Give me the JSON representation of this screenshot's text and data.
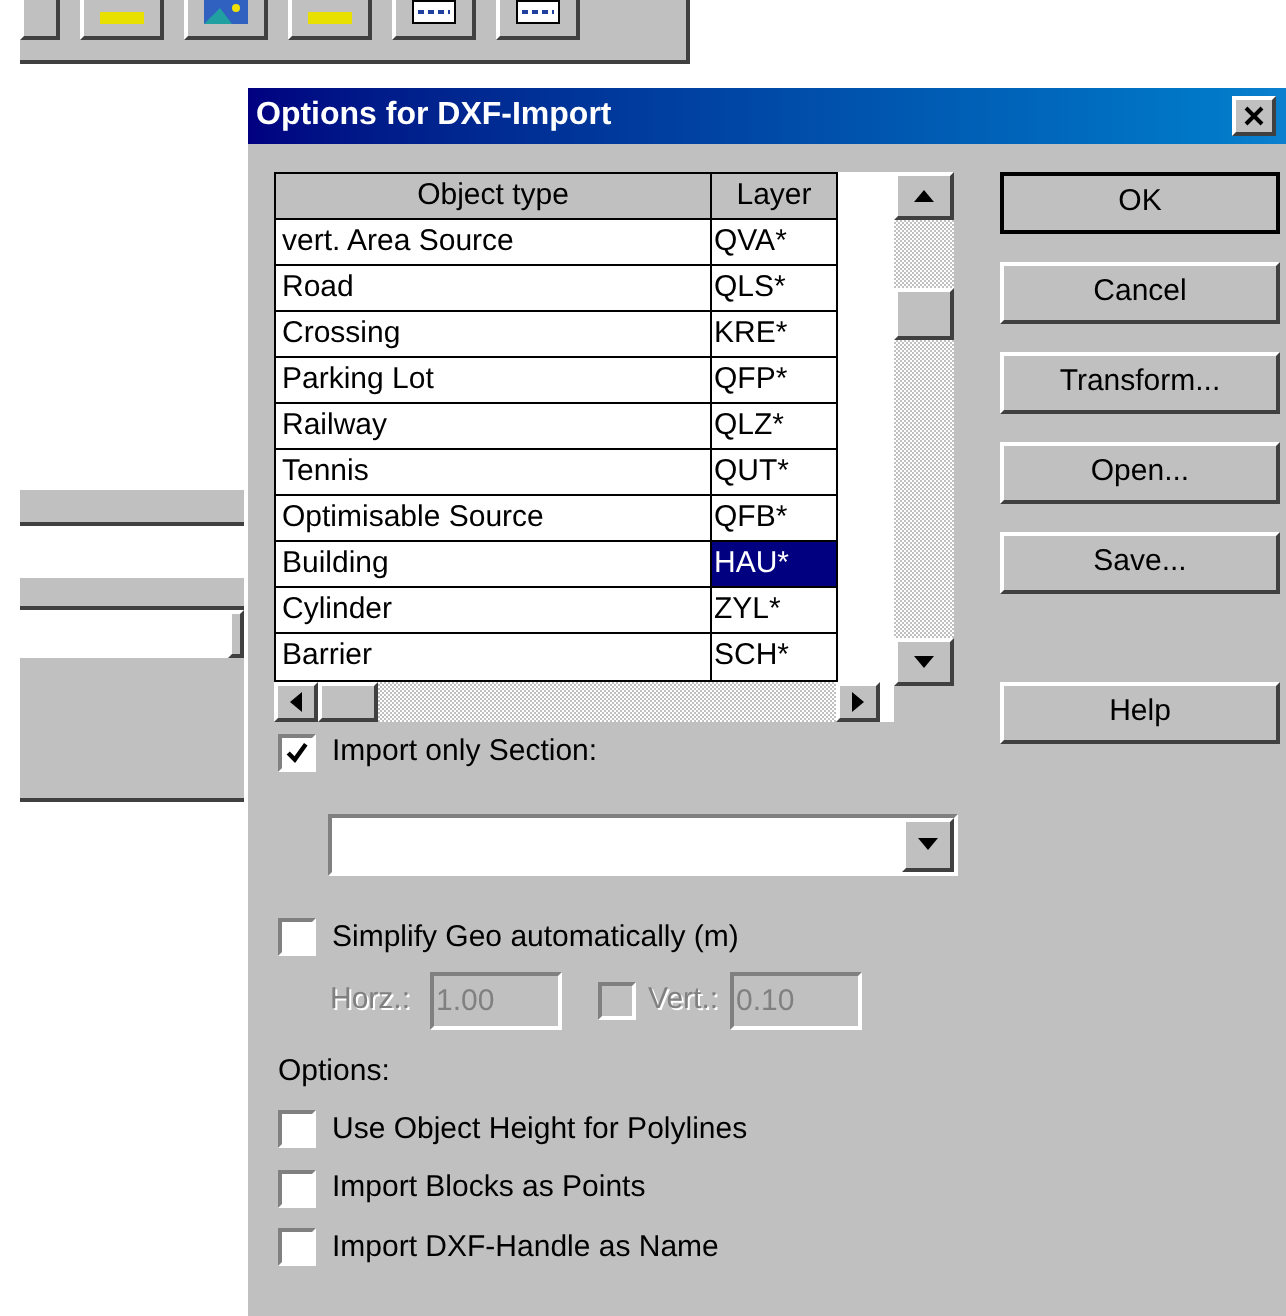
{
  "background_window": {
    "toolbar_buttons": [
      {
        "kind": "plain"
      },
      {
        "kind": "yellow"
      },
      {
        "kind": "image"
      },
      {
        "kind": "yellow"
      },
      {
        "kind": "grid"
      },
      {
        "kind": "grid"
      }
    ]
  },
  "dialog": {
    "title": "Options for DXF-Import",
    "table": {
      "columns": [
        "Object type",
        "Layer"
      ],
      "rows": [
        {
          "object_type": "vert. Area Source",
          "layer": "QVA*",
          "selected": false
        },
        {
          "object_type": "Road",
          "layer": "QLS*",
          "selected": false
        },
        {
          "object_type": "Crossing",
          "layer": "KRE*",
          "selected": false
        },
        {
          "object_type": "Parking Lot",
          "layer": "QFP*",
          "selected": false
        },
        {
          "object_type": "Railway",
          "layer": "QLZ*",
          "selected": false
        },
        {
          "object_type": "Tennis",
          "layer": "QUT*",
          "selected": false
        },
        {
          "object_type": "Optimisable Source",
          "layer": "QFB*",
          "selected": false
        },
        {
          "object_type": "Building",
          "layer": "HAU*",
          "selected": true
        },
        {
          "object_type": "Cylinder",
          "layer": "ZYL*",
          "selected": false
        },
        {
          "object_type": "Barrier",
          "layer": "SCH*",
          "selected": false
        }
      ]
    },
    "import_only_section": {
      "label": "Import only Section:",
      "checked": true
    },
    "simplify": {
      "label": "Simplify Geo automatically (m)",
      "checked": false
    },
    "horz": {
      "label": "Horz.:",
      "value": "1.00",
      "disabled": true
    },
    "vert": {
      "label": "Vert.:",
      "value": "0.10",
      "checked": false,
      "disabled": true
    },
    "options_label": "Options:",
    "options": [
      {
        "label": "Use Object Height for Polylines",
        "checked": false
      },
      {
        "label": "Import Blocks as Points",
        "checked": false
      },
      {
        "label": "Import DXF-Handle as Name",
        "checked": false
      }
    ],
    "buttons": [
      "OK",
      "Cancel",
      "Transform...",
      "Open...",
      "Save..."
    ],
    "help_button": "Help"
  }
}
